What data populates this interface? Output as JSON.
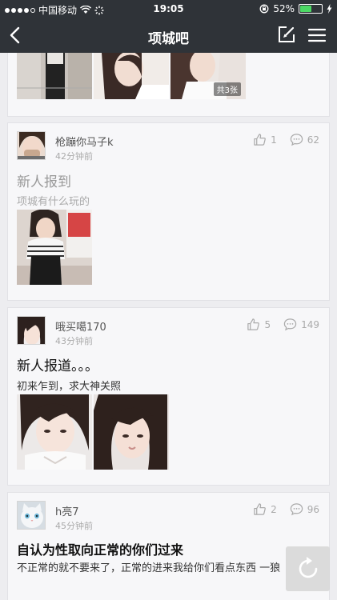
{
  "status_bar": {
    "carrier": "中国移动",
    "time": "19:05",
    "battery": "52%",
    "battery_level": 0.52
  },
  "nav": {
    "title": "项城吧",
    "back_icon": "chevron-left-icon",
    "compose_icon": "compose-icon",
    "menu_icon": "hamburger-menu-icon"
  },
  "posts": [
    {
      "photo_count_badge": "共3张"
    },
    {
      "username": "枪蹦你马子k",
      "time_ago": "42分钟前",
      "likes": "1",
      "comments": "62",
      "title": "新人报到",
      "body": "项城有什么玩的"
    },
    {
      "username": "哦买噶170",
      "time_ago": "43分钟前",
      "likes": "5",
      "comments": "149",
      "title": "新人报道。。。",
      "body": "初来乍到，求大神关照"
    },
    {
      "username": "h亮7",
      "time_ago": "45分钟前",
      "likes": "2",
      "comments": "96",
      "title": "自认为性取向正常的你们过来",
      "body": "不正常的就不要来了，正常的进来我给你们看点东西 一狼"
    }
  ],
  "colors": {
    "bar_bg": "#2f3338",
    "page_bg": "#ededf0",
    "card_bg": "#f7f7f9",
    "faded_text": "#999999",
    "strong_text": "#111111"
  }
}
